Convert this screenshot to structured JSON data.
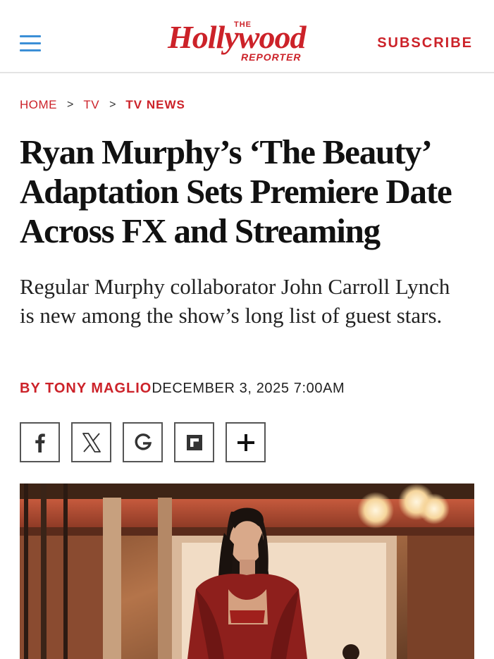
{
  "header": {
    "logo": {
      "the": "THE",
      "name": "Hollywood",
      "sub": "REPORTER"
    },
    "subscribe_label": "SUBSCRIBE",
    "menu_icon": "hamburger-menu-icon"
  },
  "breadcrumb": {
    "items": [
      "HOME",
      "TV",
      "TV NEWS"
    ],
    "separator": ">"
  },
  "article": {
    "headline": "Ryan Murphy’s ‘The Beauty’ Adaptation Sets Premiere Date Across FX and Streaming",
    "dek": "Regular Murphy collaborator John Carroll Lynch is new among the show’s long list of guest stars.",
    "author": "BY TONY MAGLIO",
    "date": "DECEMBER 3, 2025 7:00AM"
  },
  "share": {
    "buttons": [
      "facebook-icon",
      "x-icon",
      "google-icon",
      "flipboard-icon",
      "plus-icon"
    ]
  },
  "colors": {
    "brand_red": "#cc2229",
    "menu_blue": "#3b8fd6"
  }
}
